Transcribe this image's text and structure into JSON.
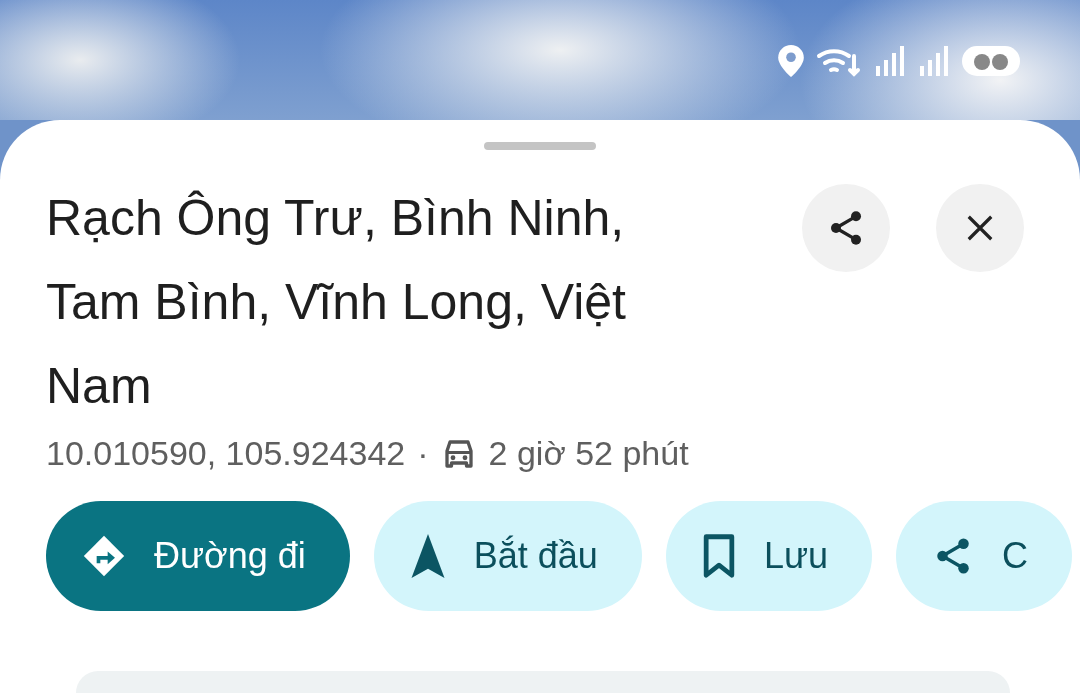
{
  "place": {
    "title": "Rạch Ông Trư, Bình Ninh, Tam Bình, Vĩnh Long, Việt Nam",
    "coordinates": "10.010590, 105.924342",
    "separator": "·",
    "drive_time": "2 giờ 52 phút"
  },
  "actions": [
    {
      "kind": "directions",
      "label": "Đường đi",
      "filled": true
    },
    {
      "kind": "start",
      "label": "Bắt đầu",
      "filled": false
    },
    {
      "kind": "save",
      "label": "Lưu",
      "filled": false
    },
    {
      "kind": "share",
      "label": "C",
      "filled": false
    }
  ]
}
